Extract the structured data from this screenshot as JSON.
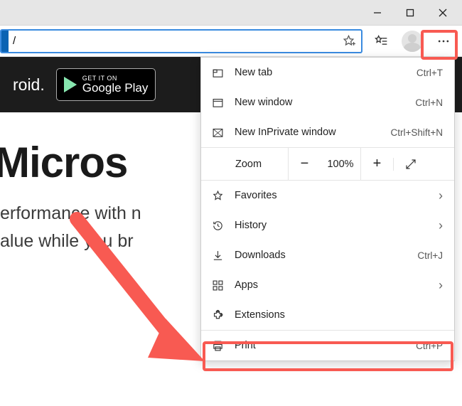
{
  "window_controls": {
    "minimize": "–",
    "maximize": "▢",
    "close": "✕"
  },
  "toolbar": {
    "url_value": "/",
    "favorite_icon": "star-plus",
    "favorites_list_icon": "star-lines",
    "more_icon": "more"
  },
  "page": {
    "banner_text": "roid.",
    "gplay_small": "GET IT ON",
    "gplay_big": "Google Play",
    "hero_title": "Micros",
    "hero_line1": "erformance with n",
    "hero_line2": "alue while you br"
  },
  "menu": {
    "items": [
      {
        "icon": "newtab",
        "label": "New tab",
        "shortcut": "Ctrl+T"
      },
      {
        "icon": "window",
        "label": "New window",
        "shortcut": "Ctrl+N"
      },
      {
        "icon": "inprivate",
        "label": "New InPrivate window",
        "shortcut": "Ctrl+Shift+N"
      }
    ],
    "zoom": {
      "label": "Zoom",
      "minus": "−",
      "value": "100%",
      "plus": "+"
    },
    "items2": [
      {
        "icon": "star",
        "label": "Favorites",
        "chev": true
      },
      {
        "icon": "history",
        "label": "History",
        "chev": true
      },
      {
        "icon": "download",
        "label": "Downloads",
        "shortcut": "Ctrl+J"
      },
      {
        "icon": "apps",
        "label": "Apps",
        "chev": true
      },
      {
        "icon": "extension",
        "label": "Extensions"
      },
      {
        "icon": "print",
        "label": "Print",
        "shortcut": "Ctrl+P"
      }
    ]
  }
}
